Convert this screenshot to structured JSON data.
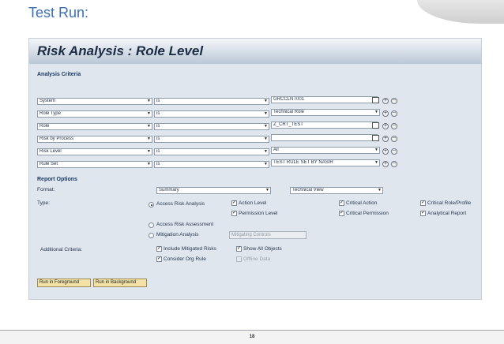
{
  "slide": {
    "title": "Test Run:",
    "page_number": "18"
  },
  "panel": {
    "title": "Risk Analysis : Role Level"
  },
  "analysis": {
    "heading": "Analysis Criteria",
    "rows": [
      {
        "field": "System",
        "op": "is",
        "value": "GRCCLNT001",
        "value_type": "text"
      },
      {
        "field": "Role Type",
        "op": "is",
        "value": "Technical Role",
        "value_type": "dropdown"
      },
      {
        "field": "Role",
        "op": "is",
        "value": "Z_CRT_TEST",
        "value_type": "text"
      },
      {
        "field": "Risk by Process",
        "op": "is",
        "value": "",
        "value_type": "text"
      },
      {
        "field": "Risk Level",
        "op": "is",
        "value": "All",
        "value_type": "dropdown"
      },
      {
        "field": "Rule Set",
        "op": "is",
        "value": "TEST RULE SET BY NASIR",
        "value_type": "dropdown"
      }
    ]
  },
  "report": {
    "heading": "Report Options",
    "format_label": "Format:",
    "format_value": "Summary",
    "view_value": "Technical View",
    "type_label": "Type:",
    "types": {
      "access_risk_analysis": "Access Risk Analysis",
      "access_risk_assessment": "Access Risk Assessment",
      "mitigation_analysis": "Mitigation Analysis",
      "mitigating_controls": "Mitigating Controls"
    },
    "levels": {
      "action_level": "Action Level",
      "permission_level": "Permission Level",
      "critical_action": "Critical Action",
      "critical_permission": "Critical Permission",
      "critical_role_profile": "Critical Role/Profile",
      "analytical_report": "Analytical Report"
    },
    "additional_label": "Additional Criteria:",
    "additional": {
      "include_mitigated": "Include Mitigated Risks",
      "show_all_objects": "Show All Objects",
      "consider_org_rule": "Consider Org Rule",
      "offline_data": "Offline Data"
    }
  },
  "buttons": {
    "foreground": "Run in Foreground",
    "background": "Run in Background"
  }
}
